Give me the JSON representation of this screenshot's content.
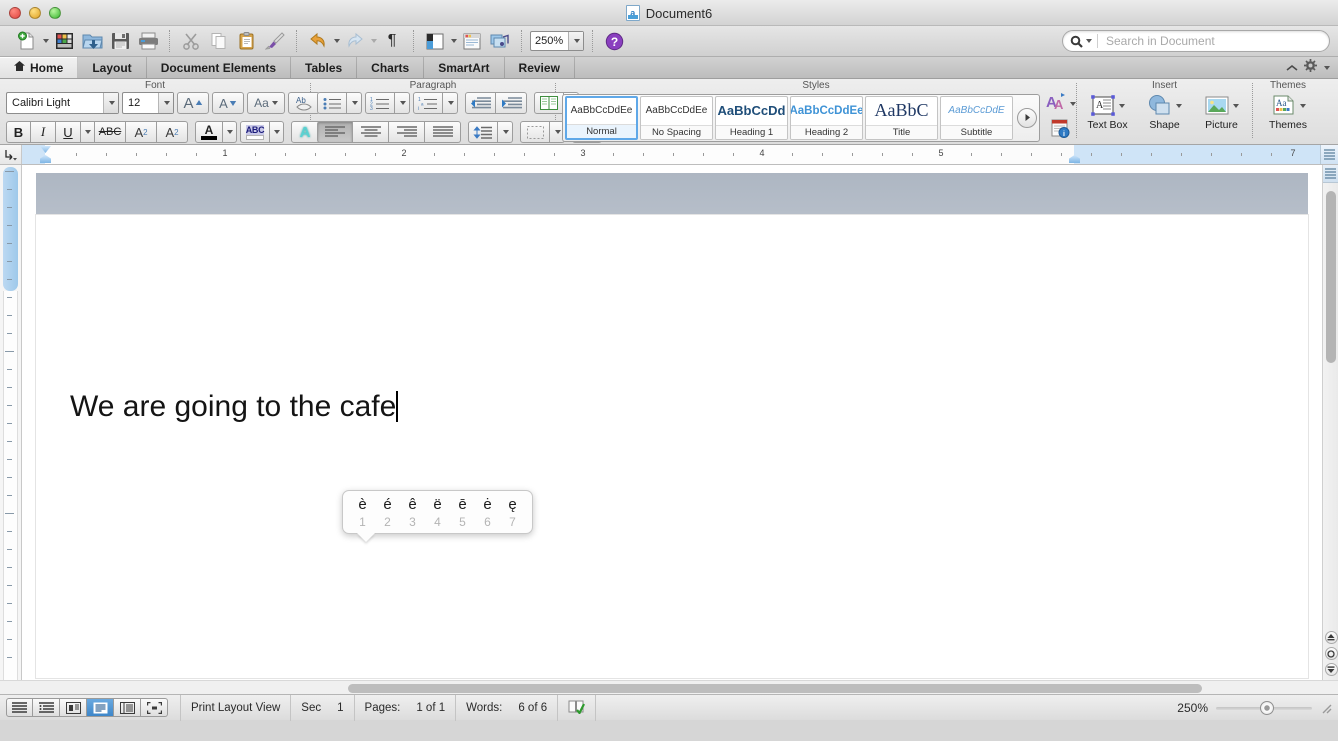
{
  "window": {
    "title": "Document6",
    "doc_icon": "word-document-icon",
    "traffic_lights": [
      "close",
      "minimize",
      "zoom"
    ]
  },
  "toolbar": {
    "items": [
      {
        "name": "new-document",
        "icon": "new-doc-icon",
        "has_menu": true
      },
      {
        "name": "open-template-gallery",
        "icon": "template-gallery-icon",
        "has_menu": false
      },
      {
        "name": "open",
        "icon": "open-folder-icon",
        "has_menu": false
      },
      {
        "name": "save",
        "icon": "floppy-save-icon",
        "has_menu": false
      },
      {
        "name": "print",
        "icon": "printer-icon",
        "has_menu": false
      },
      {
        "name": "cut",
        "icon": "scissors-icon",
        "has_menu": false
      },
      {
        "name": "copy",
        "icon": "copy-icon",
        "has_menu": false
      },
      {
        "name": "paste",
        "icon": "clipboard-paste-icon",
        "has_menu": false
      },
      {
        "name": "format-painter",
        "icon": "paintbrush-icon",
        "has_menu": false
      },
      {
        "name": "undo",
        "icon": "undo-arrow-icon",
        "has_menu": true
      },
      {
        "name": "redo",
        "icon": "redo-arrow-icon",
        "has_menu": true
      },
      {
        "name": "show-formatting",
        "icon": "pilcrow-icon",
        "has_menu": false
      },
      {
        "name": "sidebar-toggle",
        "icon": "sidebar-panel-icon",
        "has_menu": true
      },
      {
        "name": "toolbox",
        "icon": "toolbox-icon",
        "has_menu": false
      },
      {
        "name": "media-browser",
        "icon": "media-browser-icon",
        "has_menu": false
      },
      {
        "name": "help",
        "icon": "help-question-icon",
        "has_menu": false
      }
    ],
    "zoom_value": "250%"
  },
  "search": {
    "placeholder": "Search in Document",
    "value": "",
    "icon": "magnifier-icon"
  },
  "tabs": {
    "items": [
      {
        "label": "Home",
        "icon": "home-icon",
        "active": true
      },
      {
        "label": "Layout",
        "active": false
      },
      {
        "label": "Document Elements",
        "active": false
      },
      {
        "label": "Tables",
        "active": false
      },
      {
        "label": "Charts",
        "active": false
      },
      {
        "label": "SmartArt",
        "active": false
      },
      {
        "label": "Review",
        "active": false
      }
    ],
    "collapse_icon": "chevron-up-icon",
    "settings_icon": "gear-icon"
  },
  "ribbon": {
    "groups": [
      {
        "label": "Font"
      },
      {
        "label": "Paragraph"
      },
      {
        "label": "Styles"
      },
      {
        "label": "Insert"
      },
      {
        "label": "Themes"
      }
    ],
    "font": {
      "family": "Calibri Light",
      "size": "12",
      "buttons": [
        "grow-font-icon",
        "shrink-font-icon",
        "change-case-icon",
        "clear-formatting-icon",
        "bold-icon",
        "italic-icon",
        "underline-icon",
        "strikethrough-icon",
        "superscript-icon",
        "subscript-icon",
        "font-color-icon",
        "highlight-icon",
        "text-effects-icon"
      ],
      "bold_label": "B",
      "italic_label": "I",
      "underline_label": "U",
      "strike_label": "ABC",
      "sup_label": "A",
      "sub_label": "A",
      "grow_label": "A",
      "shrink_label": "A",
      "case_label": "Aa",
      "color_label": "A",
      "highlight_label": "ABC",
      "effects_label": "A",
      "clear_label": "Ab"
    },
    "paragraph": {
      "buttons": [
        "bullets-icon",
        "numbering-icon",
        "multilevel-list-icon",
        "decrease-indent-icon",
        "increase-indent-icon",
        "columns-icon",
        "align-left-icon",
        "align-center-icon",
        "align-right-icon",
        "justify-icon",
        "line-spacing-icon",
        "borders-icon",
        "sort-icon"
      ]
    },
    "styles": {
      "items": [
        {
          "preview": "AaBbCcDdEe",
          "name": "Normal",
          "selected": true,
          "kind": "normal"
        },
        {
          "preview": "AaBbCcDdEe",
          "name": "No Spacing",
          "selected": false,
          "kind": "normal"
        },
        {
          "preview": "AaBbCcDd",
          "name": "Heading 1",
          "selected": false,
          "kind": "h1"
        },
        {
          "preview": "AaBbCcDdEe",
          "name": "Heading 2",
          "selected": false,
          "kind": "h2"
        },
        {
          "preview": "AaBbC",
          "name": "Title",
          "selected": false,
          "kind": "title"
        },
        {
          "preview": "AaBbCcDdE",
          "name": "Subtitle",
          "selected": false,
          "kind": "subtitle"
        }
      ],
      "more_icon": "gallery-more-icon",
      "styles_pane_icon": "styles-pane-icon",
      "manage_styles_icon": "manage-styles-icon"
    },
    "insert": {
      "items": [
        {
          "label": "Text Box",
          "icon": "text-box-icon",
          "has_menu": true
        },
        {
          "label": "Shape",
          "icon": "shape-icon",
          "has_menu": true
        },
        {
          "label": "Picture",
          "icon": "picture-icon",
          "has_menu": true
        }
      ]
    },
    "themes": {
      "items": [
        {
          "label": "Themes",
          "icon": "themes-icon",
          "has_menu": true
        }
      ]
    }
  },
  "ruler": {
    "numbers": [
      "1",
      "2",
      "3",
      "4",
      "5",
      "7"
    ],
    "units": "inches",
    "left_indent_marker": "indent-marker",
    "right_indent_marker": "right-indent-marker",
    "tab_stop_icon": "tab-stop-icon"
  },
  "document": {
    "text": "We are going to the cafe",
    "caret_visible": true
  },
  "accent_popup": {
    "options": [
      {
        "char": "è",
        "key": "1"
      },
      {
        "char": "é",
        "key": "2"
      },
      {
        "char": "ê",
        "key": "3"
      },
      {
        "char": "ë",
        "key": "4"
      },
      {
        "char": "ē",
        "key": "5"
      },
      {
        "char": "ė",
        "key": "6"
      },
      {
        "char": "ę",
        "key": "7"
      }
    ]
  },
  "statusbar": {
    "view_buttons": [
      {
        "name": "draft-view",
        "icon": "draft-view-icon",
        "active": false
      },
      {
        "name": "outline-view",
        "icon": "outline-view-icon",
        "active": false
      },
      {
        "name": "publishing-layout-view",
        "icon": "publishing-view-icon",
        "active": false
      },
      {
        "name": "print-layout-view",
        "icon": "print-layout-icon",
        "active": true
      },
      {
        "name": "notebook-layout-view",
        "icon": "notebook-view-icon",
        "active": false
      },
      {
        "name": "focus-view",
        "icon": "focus-view-icon",
        "active": false
      }
    ],
    "view_label": "Print Layout View",
    "sec_label": "Sec",
    "sec_value": "1",
    "pages_label": "Pages:",
    "pages_value": "1 of 1",
    "words_label": "Words:",
    "words_value": "6 of 6",
    "spelling_icon": "spelling-check-icon",
    "zoom_label": "250%",
    "resize_grip": "resize-grip-icon"
  },
  "colors": {
    "accent_blue": "#3d86c9",
    "heading_blue": "#1f4e79",
    "ribbon_bg": "#e6e6e6",
    "page_band": "#b0b9c4"
  }
}
